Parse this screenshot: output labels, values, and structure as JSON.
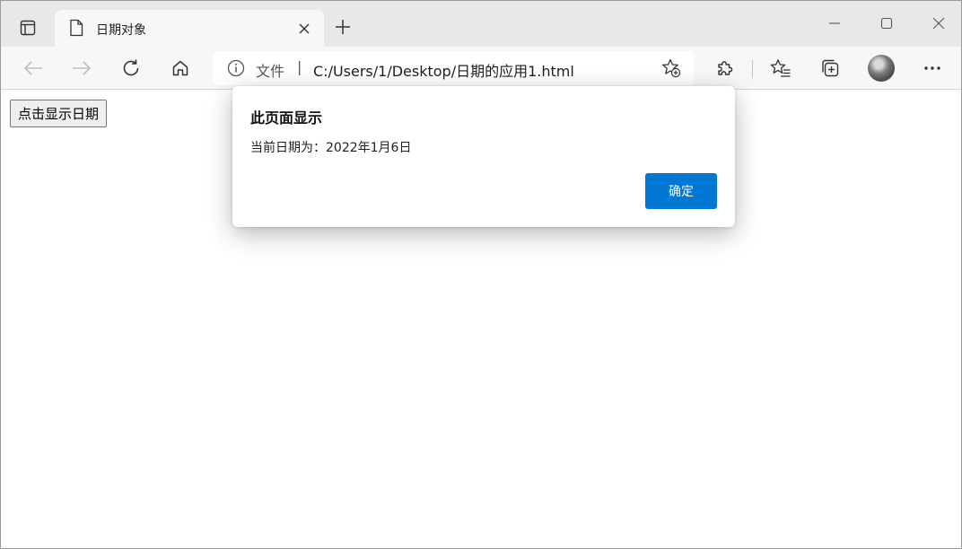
{
  "browser": {
    "tab": {
      "title": "日期对象"
    },
    "address": {
      "scheme": "文件",
      "separator": "|",
      "url": "C:/Users/1/Desktop/日期的应用1.html"
    }
  },
  "page": {
    "button_label": "点击显示日期"
  },
  "alert": {
    "title": "此页面显示",
    "message": "当前日期为：2022年1月6日",
    "ok_label": "确定"
  },
  "colors": {
    "accent": "#0078d4",
    "tabstrip": "#e8e8e8",
    "toolbar": "#f7f7f7"
  },
  "icons": [
    "tab-actions-icon",
    "page-icon",
    "close-icon",
    "plus-icon",
    "minimize-icon",
    "maximize-icon",
    "window-close-icon",
    "back-icon",
    "forward-icon",
    "refresh-icon",
    "home-icon",
    "info-icon",
    "add-favorite-icon",
    "extensions-icon",
    "favorites-icon",
    "collections-icon",
    "more-icon"
  ]
}
